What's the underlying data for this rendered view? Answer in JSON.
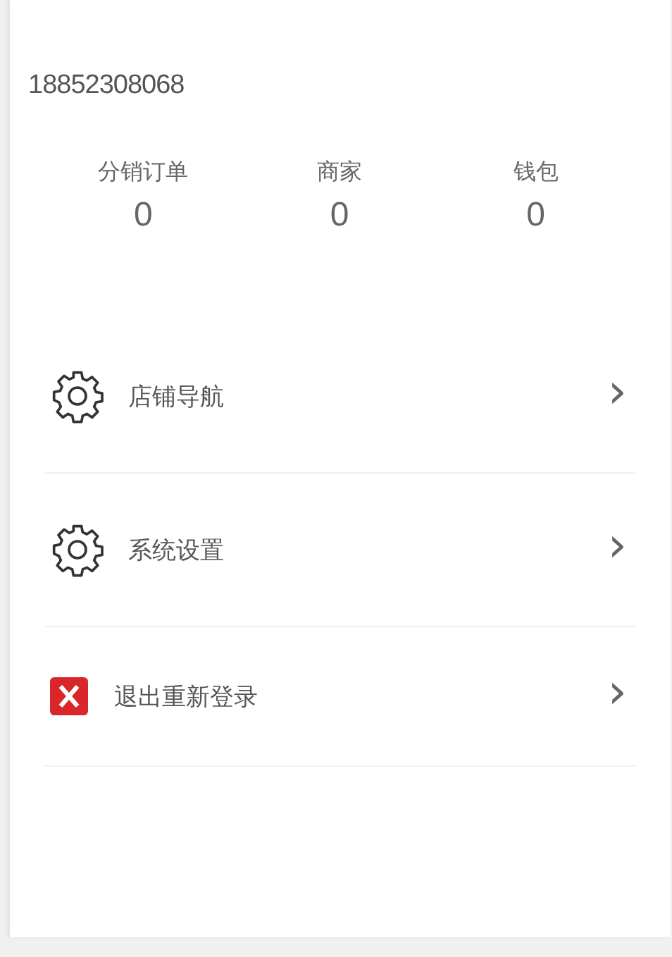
{
  "account": {
    "phone": "18852308068"
  },
  "stats": [
    {
      "label": "分销订单",
      "value": "0"
    },
    {
      "label": "商家",
      "value": "0"
    },
    {
      "label": "钱包",
      "value": "0"
    }
  ],
  "menu": [
    {
      "kind": "gear",
      "label": "店铺导航",
      "chevron": "›"
    },
    {
      "kind": "gear",
      "label": "系统设置",
      "chevron": "›"
    },
    {
      "kind": "close",
      "label": "退出重新登录",
      "chevron": "›"
    }
  ]
}
